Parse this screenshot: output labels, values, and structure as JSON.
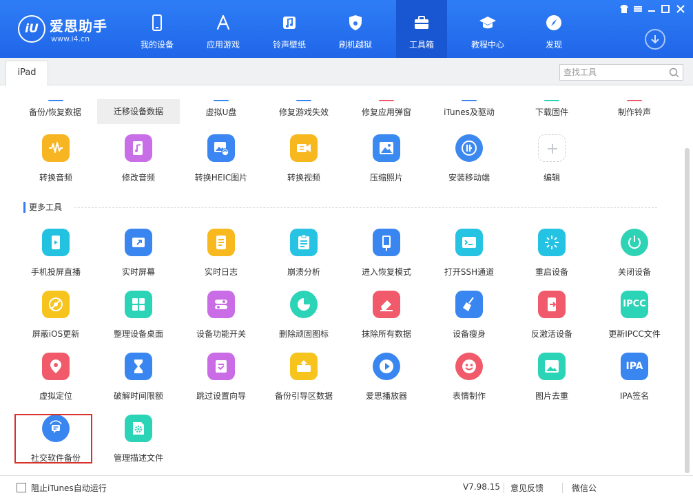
{
  "app": {
    "name": "爱思助手",
    "url": "www.i4.cn",
    "logo_mark": "iU"
  },
  "colors": {
    "topbar": "#2f7df6",
    "active_nav": "#1856d2",
    "highlight_border": "#d9312b"
  },
  "nav": [
    {
      "label": "我的设备",
      "icon": "phone-icon"
    },
    {
      "label": "应用游戏",
      "icon": "app-store-icon"
    },
    {
      "label": "铃声壁纸",
      "icon": "music-icon"
    },
    {
      "label": "刷机越狱",
      "icon": "shield-icon"
    },
    {
      "label": "工具箱",
      "icon": "toolbox-icon",
      "active": true
    },
    {
      "label": "教程中心",
      "icon": "graduation-cap-icon"
    },
    {
      "label": "发现",
      "icon": "compass-icon"
    }
  ],
  "tab": {
    "label": "iPad"
  },
  "search": {
    "placeholder": "查找工具"
  },
  "top_categories": [
    "备份/恢复数据",
    "迁移设备数据",
    "虚拟U盘",
    "修复游戏失效",
    "修复应用弹窗",
    "iTunes及驱动",
    "下载固件",
    "制作铃声"
  ],
  "row1": [
    {
      "label": "转换音频",
      "icon": "audio-wave-icon",
      "color": "#f6b521"
    },
    {
      "label": "修改音频",
      "icon": "music-note-icon",
      "color": "#c86ee6"
    },
    {
      "label": "转换HEIC图片",
      "icon": "image-convert-icon",
      "color": "#3b86f2"
    },
    {
      "label": "转换视频",
      "icon": "video-icon",
      "color": "#f7b81f"
    },
    {
      "label": "压缩照片",
      "icon": "photo-icon",
      "color": "#3b8af1"
    },
    {
      "label": "安装移动端",
      "icon": "i4-app-icon",
      "color": "#3d88ee"
    },
    {
      "label": "编辑",
      "icon": "plus-icon",
      "color": "#ffffff"
    }
  ],
  "section_more": "更多工具",
  "more_tools": [
    {
      "label": "手机投屏直播",
      "icon": "screen-cast-icon",
      "color": "#22c2e0"
    },
    {
      "label": "实时屏幕",
      "icon": "realtime-screen-icon",
      "color": "#3a86f0"
    },
    {
      "label": "实时日志",
      "icon": "log-icon",
      "color": "#f7b91e"
    },
    {
      "label": "崩溃分析",
      "icon": "crash-report-icon",
      "color": "#27c3e2"
    },
    {
      "label": "进入恢复模式",
      "icon": "recovery-mode-icon",
      "color": "#3a86f0"
    },
    {
      "label": "打开SSH通道",
      "icon": "terminal-icon",
      "color": "#27c3e2"
    },
    {
      "label": "重启设备",
      "icon": "restart-icon",
      "color": "#25c3e3"
    },
    {
      "label": "关闭设备",
      "icon": "power-icon",
      "color": "#2dd3b4"
    },
    {
      "label": "屏蔽iOS更新",
      "icon": "block-update-icon",
      "color": "#f6c41d"
    },
    {
      "label": "整理设备桌面",
      "icon": "grid-icon",
      "color": "#2bd3b7"
    },
    {
      "label": "设备功能开关",
      "icon": "toggle-icon",
      "color": "#c96ce6"
    },
    {
      "label": "删除顽固图标",
      "icon": "pie-icon",
      "color": "#2bd3b7"
    },
    {
      "label": "抹除所有数据",
      "icon": "eraser-icon",
      "color": "#f05a6a"
    },
    {
      "label": "设备瘦身",
      "icon": "broom-icon",
      "color": "#3a86f0"
    },
    {
      "label": "反激活设备",
      "icon": "deactivate-icon",
      "color": "#f05a6a"
    },
    {
      "label": "更新IPCC文件",
      "icon": "ipcc-icon",
      "color": "#2bd3b7",
      "text": "IPCC"
    },
    {
      "label": "虚拟定位",
      "icon": "location-pin-icon",
      "color": "#f05a6a"
    },
    {
      "label": "破解时间限额",
      "icon": "hourglass-icon",
      "color": "#3a86f0"
    },
    {
      "label": "跳过设置向导",
      "icon": "skip-setup-icon",
      "color": "#c96ce6"
    },
    {
      "label": "备份引导区数据",
      "icon": "backup-boot-icon",
      "color": "#f6c41d"
    },
    {
      "label": "爱思播放器",
      "icon": "play-icon",
      "color": "#3a86f0"
    },
    {
      "label": "表情制作",
      "icon": "emoji-icon",
      "color": "#f05a6a"
    },
    {
      "label": "图片去重",
      "icon": "image-dedupe-icon",
      "color": "#2bd3b7"
    },
    {
      "label": "IPA签名",
      "icon": "ipa-icon",
      "color": "#3a86f0",
      "text": "IPA"
    },
    {
      "label": "社交软件备份",
      "icon": "chat-backup-icon",
      "color": "#3a86f0"
    },
    {
      "label": "管理描述文件",
      "icon": "profile-gear-icon",
      "color": "#2bd3b7"
    }
  ],
  "footer": {
    "checkbox_label": "阻止iTunes自动运行",
    "version": "V7.98.15",
    "feedback": "意见反馈",
    "wechat": "微信公"
  }
}
